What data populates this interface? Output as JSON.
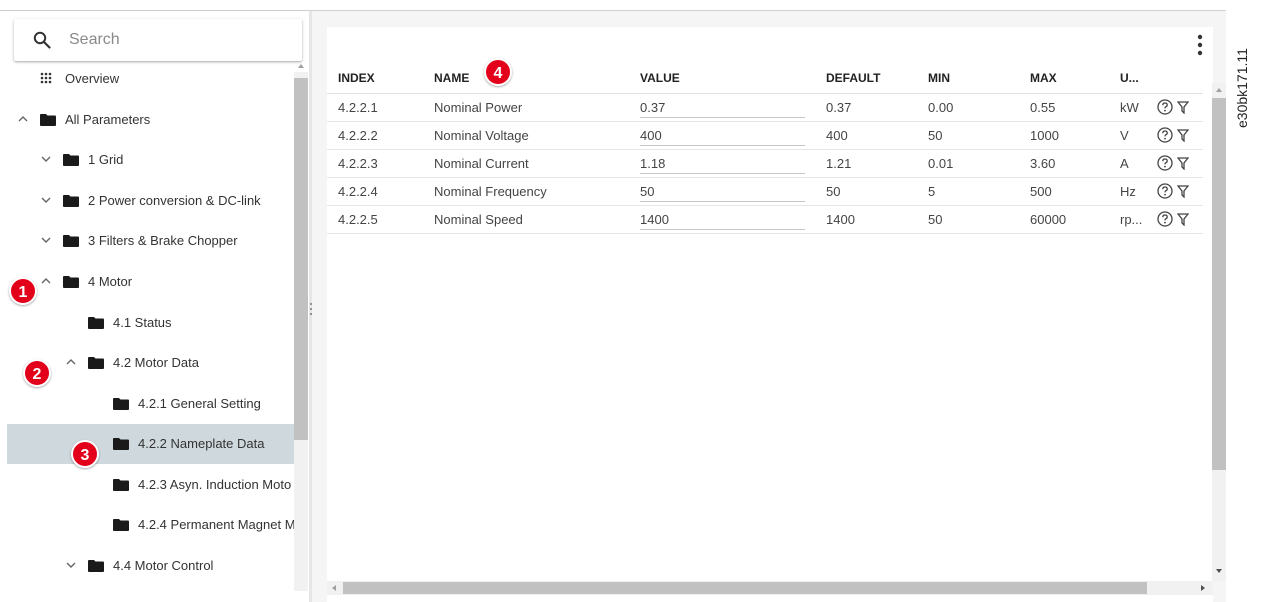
{
  "search": {
    "placeholder": "Search"
  },
  "tree": {
    "items": [
      {
        "label": "Overview",
        "icon": "grid-icon"
      },
      {
        "label": "All Parameters",
        "icon": "folder-icon",
        "expanded": true
      },
      {
        "label": "1 Grid",
        "icon": "folder-icon",
        "expanded": false
      },
      {
        "label": "2 Power conversion & DC-link",
        "icon": "folder-icon",
        "expanded": false
      },
      {
        "label": "3 Filters & Brake Chopper",
        "icon": "folder-icon",
        "expanded": false
      },
      {
        "label": "4 Motor",
        "icon": "folder-icon",
        "expanded": true
      },
      {
        "label": "4.1 Status",
        "icon": "folder-icon"
      },
      {
        "label": "4.2 Motor Data",
        "icon": "folder-icon",
        "expanded": true
      },
      {
        "label": "4.2.1 General Setting",
        "icon": "folder-icon"
      },
      {
        "label": "4.2.2 Nameplate Data",
        "icon": "folder-icon",
        "selected": true
      },
      {
        "label": "4.2.3 Asyn. Induction Moto",
        "icon": "folder-icon"
      },
      {
        "label": "4.2.4 Permanent Magnet M",
        "icon": "folder-icon"
      },
      {
        "label": "4.4 Motor Control",
        "icon": "folder-icon",
        "expanded": false
      }
    ]
  },
  "badges": [
    "1",
    "2",
    "3",
    "4"
  ],
  "table": {
    "headers": [
      "INDEX",
      "NAME",
      "VALUE",
      "DEFAULT",
      "MIN",
      "MAX",
      "U..."
    ],
    "rows": [
      {
        "index": "4.2.2.1",
        "name": "Nominal Power",
        "value": "0.37",
        "default": "0.37",
        "min": "0.00",
        "max": "0.55",
        "unit": "kW"
      },
      {
        "index": "4.2.2.2",
        "name": "Nominal Voltage",
        "value": "400",
        "default": "400",
        "min": "50",
        "max": "1000",
        "unit": "V"
      },
      {
        "index": "4.2.2.3",
        "name": "Nominal Current",
        "value": "1.18",
        "default": "1.21",
        "min": "0.01",
        "max": "3.60",
        "unit": "A"
      },
      {
        "index": "4.2.2.4",
        "name": "Nominal Frequency",
        "value": "50",
        "default": "50",
        "min": "5",
        "max": "500",
        "unit": "Hz"
      },
      {
        "index": "4.2.2.5",
        "name": "Nominal Speed",
        "value": "1400",
        "default": "1400",
        "min": "50",
        "max": "60000",
        "unit": "rp..."
      }
    ]
  },
  "side_code": "e30bk171.11",
  "colors": {
    "badge": "#e2001a",
    "selected_row": "#cfd8dc",
    "scroll_thumb": "#c1c1c1"
  }
}
